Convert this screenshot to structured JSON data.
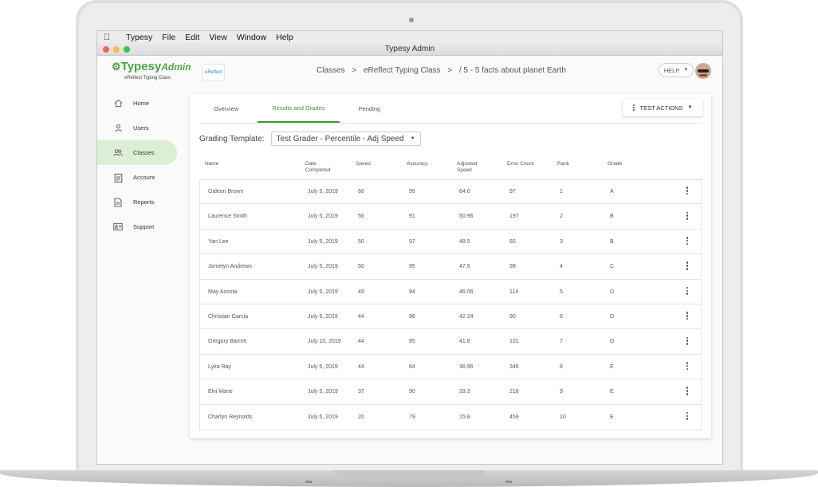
{
  "window": {
    "title": "Typesy Admin",
    "menu": [
      "Typesy",
      "File",
      "Edit",
      "View",
      "Window",
      "Help"
    ]
  },
  "brand": {
    "name": "Typesy",
    "admin": "Admin",
    "sub": "eReflect Typing Class",
    "chip": "eReflect"
  },
  "breadcrumb": [
    "Classes",
    ">",
    "eReflect Typing Class",
    ">",
    "/ 5 - 5 facts about planet Earth"
  ],
  "header": {
    "help_label": "HELP"
  },
  "sidebar": {
    "items": [
      {
        "label": "Home",
        "icon": "home-icon",
        "active": false
      },
      {
        "label": "Users",
        "icon": "user-icon",
        "active": false
      },
      {
        "label": "Classes",
        "icon": "classes-icon",
        "active": true
      },
      {
        "label": "Account",
        "icon": "clipboard-icon",
        "active": false
      },
      {
        "label": "Reports",
        "icon": "document-icon",
        "active": false
      },
      {
        "label": "Support",
        "icon": "contact-card-icon",
        "active": false
      }
    ]
  },
  "tabs": [
    "Overview",
    "Results and Grades",
    "Pending"
  ],
  "active_tab": "Results and Grades",
  "test_actions_label": "TEST ACTIONS",
  "grading": {
    "label": "Grading Template:",
    "selected": "Test Grader - Percentile - Adj Speed"
  },
  "table": {
    "columns": [
      "Name",
      "Date\nCompleted",
      "Speed",
      "Accuracy",
      "Adjusted\nSpeed",
      "Error Count",
      "Rank",
      "Grade"
    ],
    "rows": [
      [
        "Gideon Brown",
        "July 5, 2019",
        "68",
        "95",
        "64.6",
        "97",
        "1",
        "A"
      ],
      [
        "Laurence Smith",
        "July 5, 2019",
        "56",
        "91",
        "50.96",
        "197",
        "2",
        "B"
      ],
      [
        "Yan Lee",
        "July 5, 2019",
        "50",
        "97",
        "48.5",
        "65",
        "3",
        "B"
      ],
      [
        "Jomelyn Andrews",
        "July 5, 2019",
        "50",
        "95",
        "47.5",
        "99",
        "4",
        "C"
      ],
      [
        "May Acosta",
        "July 5, 2019",
        "49",
        "94",
        "46.06",
        "114",
        "5",
        "D"
      ],
      [
        "Christian Garcia",
        "July 5, 2019",
        "44",
        "96",
        "42.24",
        "90",
        "6",
        "D"
      ],
      [
        "Gregory Barrett",
        "July 10, 2019",
        "44",
        "95",
        "41.8",
        "101",
        "7",
        "D"
      ],
      [
        "Lyka Ray",
        "July 5, 2019",
        "44",
        "84",
        "36.96",
        "346",
        "8",
        "E"
      ],
      [
        "Elvi Mane",
        "July 5, 2019",
        "37",
        "90",
        "33.3",
        "218",
        "9",
        "E"
      ],
      [
        "Charlyn Reynolds",
        "July 5, 2019",
        "20",
        "79",
        "15.8",
        "459",
        "10",
        "E"
      ]
    ]
  },
  "colors": {
    "accent": "#3a9a35",
    "active_nav_bg": "#dcefd5",
    "traffic_red": "#fc605c",
    "traffic_yellow": "#fdbc40",
    "traffic_green": "#34c84a"
  }
}
